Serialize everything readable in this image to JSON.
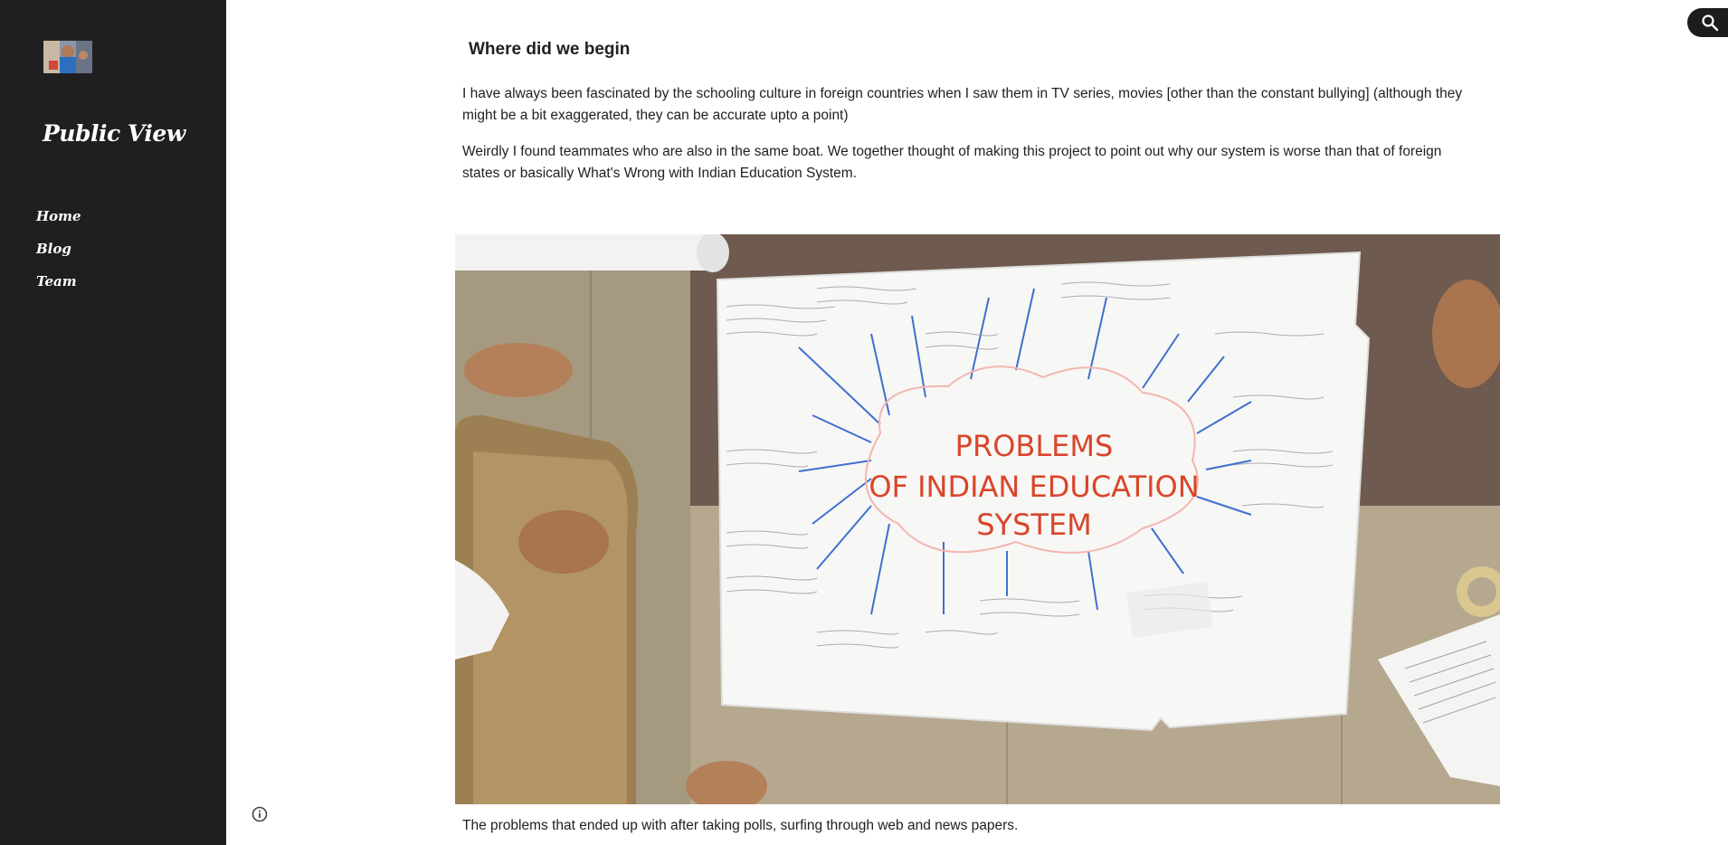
{
  "site": {
    "title": "Public View"
  },
  "nav": {
    "items": [
      {
        "label": "Home"
      },
      {
        "label": "Blog"
      },
      {
        "label": "Team"
      }
    ]
  },
  "main": {
    "heading": "Where did we begin",
    "paragraphs": [
      "I have always been fascinated by the schooling culture in foreign countries when I saw them in TV series, movies [other than the constant bullying] (although they might be a bit exaggerated, they can be accurate upto a point)",
      "Weirdly I found teammates who are also in the same boat. We together thought of making this project to point out why our system is worse than that of foreign states or basically What's Wrong with Indian Education System."
    ],
    "image": {
      "poster_lines": [
        "PROBLEMS",
        "OF INDIAN EDUCATION",
        "SYSTEM"
      ]
    },
    "caption": "The problems that ended up with after taking polls, surfing through web and news papers."
  },
  "colors": {
    "sidebar": "#1f1f1f",
    "text": "#212121",
    "poster_title": "#d9452b",
    "poster_spokes": "#3f6fcf"
  },
  "icons": {
    "search": "search-icon",
    "info": "info-icon"
  }
}
